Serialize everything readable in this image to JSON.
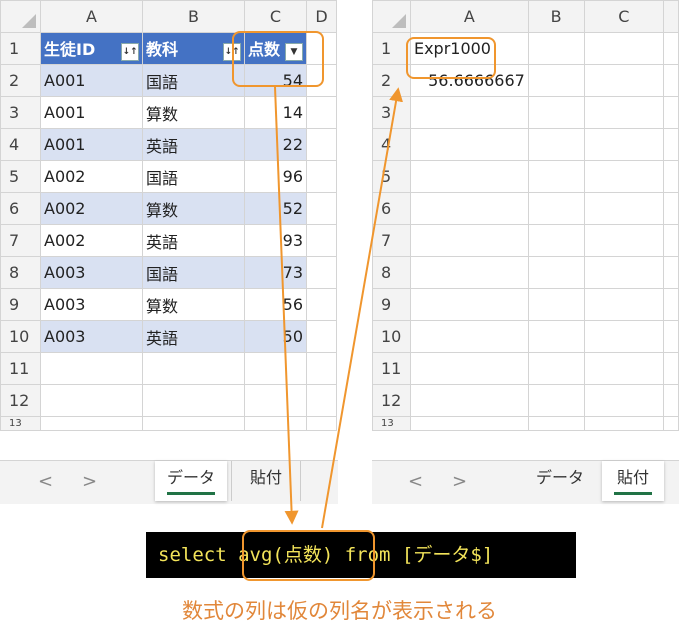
{
  "left_sheet": {
    "columns": [
      "A",
      "B",
      "C",
      "D"
    ],
    "row_numbers": [
      "1",
      "2",
      "3",
      "4",
      "5",
      "6",
      "7",
      "8",
      "9",
      "10",
      "11",
      "12",
      "13"
    ],
    "headers": [
      "生徒ID",
      "教科",
      "点数"
    ],
    "rows": [
      [
        "A001",
        "国語",
        "54"
      ],
      [
        "A001",
        "算数",
        "14"
      ],
      [
        "A001",
        "英語",
        "22"
      ],
      [
        "A002",
        "国語",
        "96"
      ],
      [
        "A002",
        "算数",
        "52"
      ],
      [
        "A002",
        "英語",
        "93"
      ],
      [
        "A003",
        "国語",
        "73"
      ],
      [
        "A003",
        "算数",
        "56"
      ],
      [
        "A003",
        "英語",
        "50"
      ]
    ],
    "tabs": {
      "active": "データ",
      "other": "貼付"
    },
    "nav": {
      "prev": "<",
      "next": ">"
    }
  },
  "right_sheet": {
    "columns": [
      "A",
      "B",
      "C"
    ],
    "row_numbers": [
      "1",
      "2",
      "3",
      "4",
      "5",
      "6",
      "7",
      "8",
      "9",
      "10",
      "11",
      "12",
      "13"
    ],
    "cells": {
      "a1": "Expr1000",
      "a2": "56.6666667"
    },
    "tabs": {
      "other": "データ",
      "active": "貼付"
    },
    "nav": {
      "prev": "<",
      "next": ">"
    }
  },
  "sql": {
    "part1": "select ",
    "part2": "avg(点数)",
    "part3": " from [データ$]"
  },
  "caption": "数式の列は仮の列名が表示される",
  "colors": {
    "accent": "#f0962e",
    "table_header": "#4472c4",
    "band": "#d9e1f2",
    "sql_text": "#f3e45a"
  }
}
